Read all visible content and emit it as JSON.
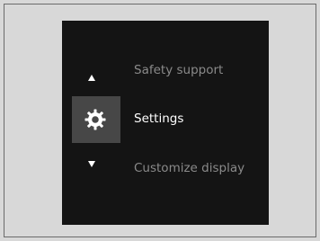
{
  "menu": {
    "items": [
      {
        "label": "Safety support",
        "state": "unselected"
      },
      {
        "label": "Settings",
        "state": "selected",
        "icon": "gear-icon"
      },
      {
        "label": "Customize display",
        "state": "unselected"
      }
    ],
    "scroll_up_icon": "arrow-up-icon",
    "scroll_down_icon": "arrow-down-icon"
  },
  "colors": {
    "background": "#d8d8d8",
    "screen": "#141414",
    "selected_highlight": "#474747",
    "text_active": "#ffffff",
    "text_inactive": "#8a8a8a"
  }
}
